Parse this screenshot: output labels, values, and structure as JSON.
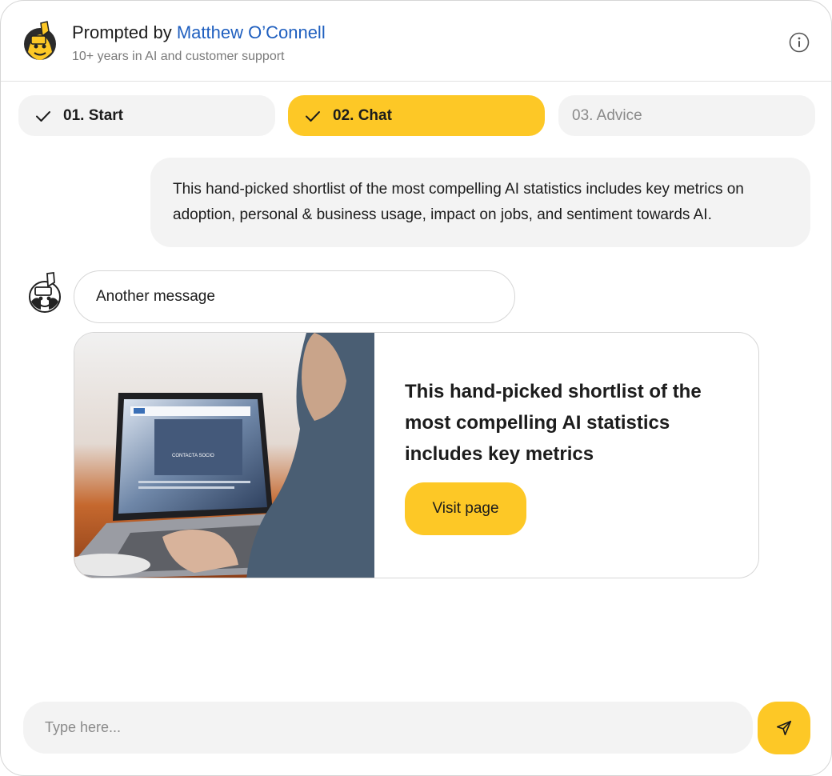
{
  "header": {
    "prompted_by": "Prompted by ",
    "author_name": "Matthew O’Connell",
    "subtitle": "10+ years in AI and customer support",
    "avatar_icon": "mascot-avatar-icon",
    "info_icon": "info-icon"
  },
  "steps": [
    {
      "label": "01. Start",
      "state": "completed"
    },
    {
      "label": "02. Chat",
      "state": "active"
    },
    {
      "label": "03. Advice",
      "state": "pending"
    }
  ],
  "chat": {
    "user_message": "This hand-picked shortlist of the most compelling AI statistics includes key metrics on adoption, personal & business usage, impact on jobs, and sentiment towards AI.",
    "bot_message": "Another message",
    "card": {
      "text": "This hand-picked shortlist of the most compelling AI statistics includes key metrics",
      "button_label": "Visit page",
      "image_screen_text": "CONTACTA SOCIO"
    }
  },
  "composer": {
    "placeholder": "Type here...",
    "send_icon": "send-icon"
  },
  "colors": {
    "accent": "#fdc826",
    "link": "#1f5fbf",
    "muted_bg": "#f3f3f3",
    "border": "#d6d6d6"
  }
}
